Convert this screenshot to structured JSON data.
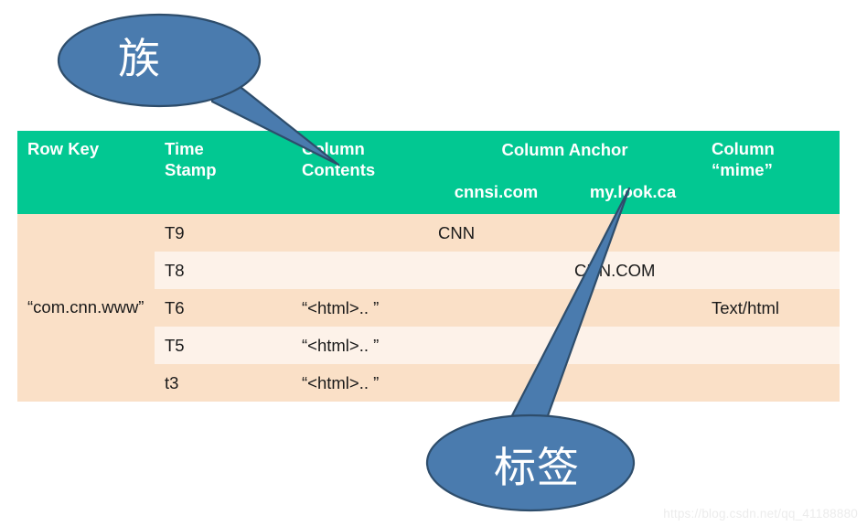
{
  "table": {
    "headers": {
      "row_key": "Row Key",
      "time_stamp": "Time\nStamp",
      "time_stamp_line1": "Time",
      "time_stamp_line2": "Stamp",
      "column_contents_line1": "Column",
      "column_contents_line2": "Contents",
      "column_anchor": "Column Anchor",
      "anchor_sub_1": "cnnsi.com",
      "anchor_sub_2": "my.look.ca",
      "column_mime_line1": "Column",
      "column_mime_line2": "“mime”"
    },
    "row_key_value": "“com.cnn.www”",
    "rows": [
      {
        "time_stamp": "T9",
        "column_contents": "",
        "cnnsi_com": "CNN",
        "my_look_ca": "",
        "column_mime": ""
      },
      {
        "time_stamp": "T8",
        "column_contents": "",
        "cnnsi_com": "",
        "my_look_ca": "CNN.COM",
        "column_mime": ""
      },
      {
        "time_stamp": "T6",
        "column_contents": "“<html>.. ”",
        "cnnsi_com": "",
        "my_look_ca": "",
        "column_mime": "Text/html"
      },
      {
        "time_stamp": "T5",
        "column_contents": "“<html>.. ”",
        "cnnsi_com": "",
        "my_look_ca": "",
        "column_mime": ""
      },
      {
        "time_stamp": "t3",
        "column_contents": "“<html>.. ”",
        "cnnsi_com": "",
        "my_look_ca": "",
        "column_mime": ""
      }
    ]
  },
  "callouts": {
    "top": {
      "text": "族",
      "fill_color": "#4A7BAE",
      "stroke_color": "#2E4D6B"
    },
    "bottom": {
      "text": "标签",
      "fill_color": "#4A7BAE",
      "stroke_color": "#2E4D6B"
    }
  },
  "watermark": {
    "text": "https://blog.csdn.net/qq_41188880"
  },
  "colors": {
    "header_green": "#02C892",
    "row_dark": "#FAE0C7",
    "row_light": "#FDF2E9",
    "text_dark": "#1A1A1A",
    "header_text": "#FFFFFF"
  }
}
